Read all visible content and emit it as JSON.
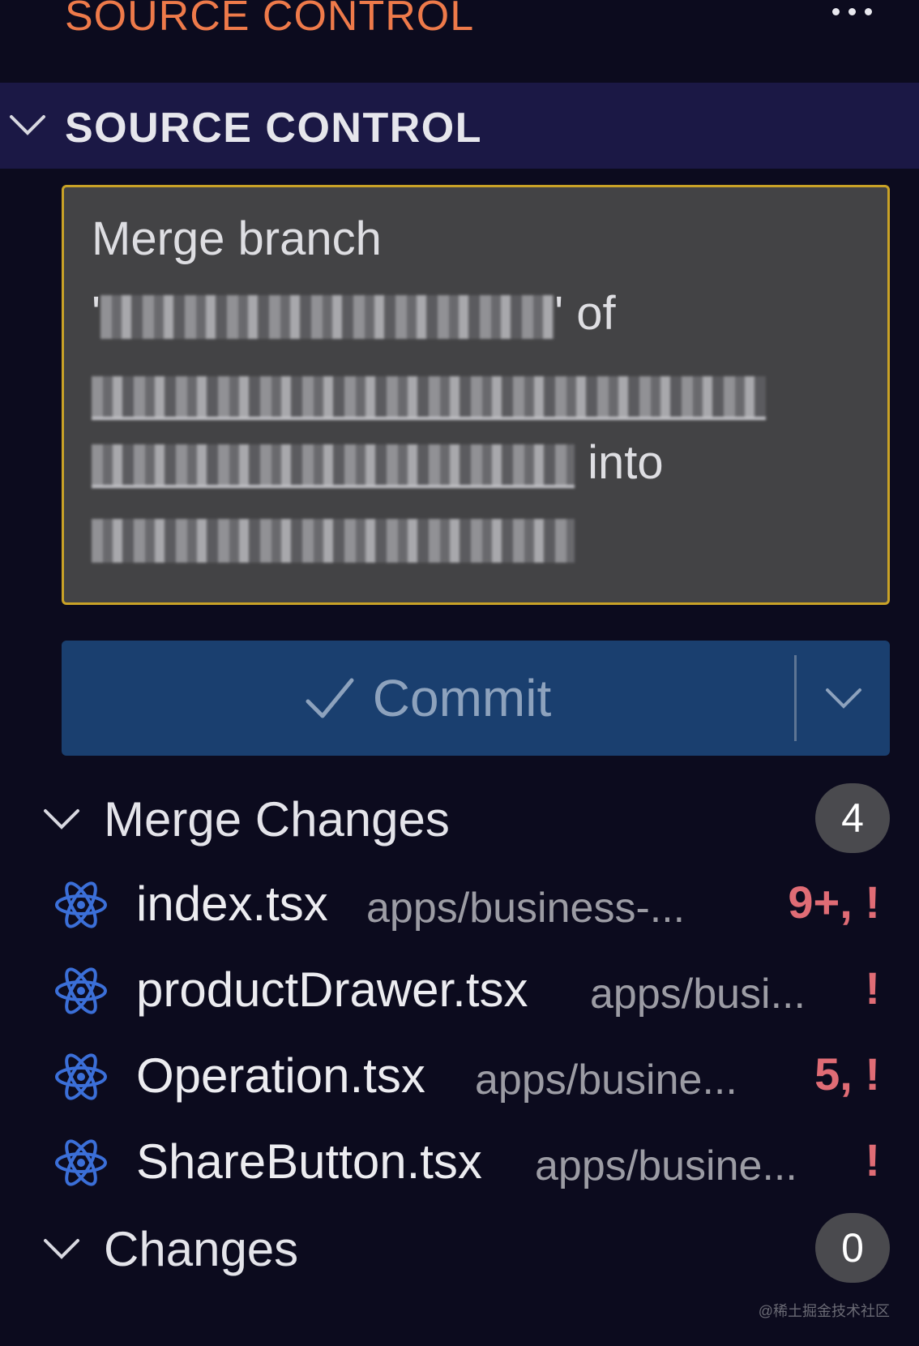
{
  "topbar": {
    "title": "SOURCE CONTROL",
    "more_icon": "ellipsis-icon"
  },
  "section": {
    "title": "SOURCE CONTROL",
    "chevron_icon": "chevron-down-icon"
  },
  "commit_message": {
    "line1": "Merge branch",
    "line2_suffix": "' of",
    "line2_prefix": "'",
    "line4_suffix": " into"
  },
  "commit_button": {
    "label": "Commit",
    "icon": "check-icon",
    "dropdown_icon": "chevron-down-icon"
  },
  "groups": [
    {
      "title": "Merge Changes",
      "count": "4",
      "files": [
        {
          "name": "index.tsx",
          "path": "apps/business-...",
          "status": "9+, !",
          "icon": "react-icon"
        },
        {
          "name": "productDrawer.tsx",
          "path": "apps/busi...",
          "status": "!",
          "icon": "react-icon"
        },
        {
          "name": "Operation.tsx",
          "path": "apps/busine...",
          "status": "5, !",
          "icon": "react-icon"
        },
        {
          "name": "ShareButton.tsx",
          "path": "apps/busine...",
          "status": "!",
          "icon": "react-icon"
        }
      ]
    },
    {
      "title": "Changes",
      "count": "0",
      "files": []
    }
  ],
  "colors": {
    "background": "#0c0b1e",
    "header_bg": "#1b1845",
    "topbar_title": "#ee7a4a",
    "input_border": "#c9a227",
    "commit_bg": "#1a3f6f",
    "status_red": "#e06c75",
    "react_blue": "#3b6fd8"
  },
  "watermark": "@稀土掘金技术社区"
}
